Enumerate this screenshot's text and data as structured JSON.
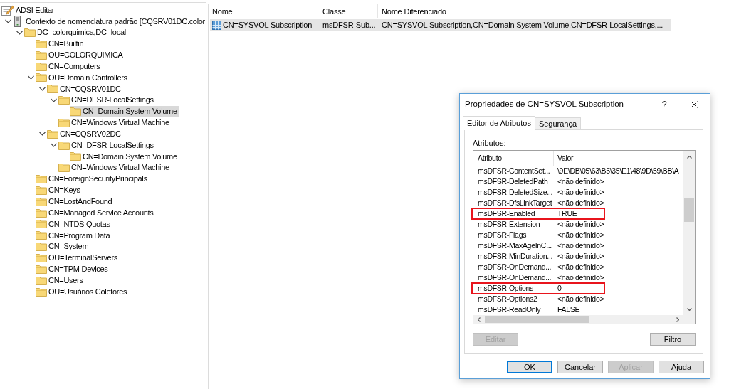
{
  "tree": {
    "items": [
      {
        "label": "ADSI Editar",
        "kind": "app",
        "selected": false,
        "children": [
          {
            "label": "Contexto de nomenclatura padrão [CQSRV01DC.color",
            "kind": "server",
            "expanded": true,
            "selected": false,
            "children": [
              {
                "label": "DC=colorquimica,DC=local",
                "kind": "folder",
                "expanded": true,
                "selected": false,
                "children": [
                  {
                    "label": "CN=Builtin",
                    "kind": "folder",
                    "selected": false
                  },
                  {
                    "label": "OU=COLORQUIMICA",
                    "kind": "folder",
                    "selected": false
                  },
                  {
                    "label": "CN=Computers",
                    "kind": "folder",
                    "selected": false
                  },
                  {
                    "label": "OU=Domain Controllers",
                    "kind": "folder",
                    "expanded": true,
                    "selected": false,
                    "children": [
                      {
                        "label": "CN=CQSRV01DC",
                        "kind": "folder",
                        "expanded": true,
                        "selected": false,
                        "children": [
                          {
                            "label": "CN=DFSR-LocalSettings",
                            "kind": "folder",
                            "expanded": true,
                            "selected": false,
                            "children": [
                              {
                                "label": "CN=Domain System Volume",
                                "kind": "folder",
                                "selected": true
                              }
                            ]
                          },
                          {
                            "label": "CN=Windows Virtual Machine",
                            "kind": "folder",
                            "selected": false
                          }
                        ]
                      },
                      {
                        "label": "CN=CQSRV02DC",
                        "kind": "folder",
                        "expanded": true,
                        "selected": false,
                        "children": [
                          {
                            "label": "CN=DFSR-LocalSettings",
                            "kind": "folder",
                            "expanded": true,
                            "selected": false,
                            "children": [
                              {
                                "label": "CN=Domain System Volume",
                                "kind": "folder",
                                "selected": false
                              }
                            ]
                          },
                          {
                            "label": "CN=Windows Virtual Machine",
                            "kind": "folder",
                            "selected": false
                          }
                        ]
                      }
                    ]
                  },
                  {
                    "label": "CN=ForeignSecurityPrincipals",
                    "kind": "folder",
                    "selected": false
                  },
                  {
                    "label": "CN=Keys",
                    "kind": "folder",
                    "selected": false
                  },
                  {
                    "label": "CN=LostAndFound",
                    "kind": "folder",
                    "selected": false
                  },
                  {
                    "label": "CN=Managed Service Accounts",
                    "kind": "folder",
                    "selected": false
                  },
                  {
                    "label": "CN=NTDS Quotas",
                    "kind": "folder",
                    "selected": false
                  },
                  {
                    "label": "CN=Program Data",
                    "kind": "folder",
                    "selected": false
                  },
                  {
                    "label": "CN=System",
                    "kind": "folder",
                    "selected": false
                  },
                  {
                    "label": "OU=TerminalServers",
                    "kind": "folder",
                    "selected": false
                  },
                  {
                    "label": "CN=TPM Devices",
                    "kind": "folder",
                    "selected": false
                  },
                  {
                    "label": "CN=Users",
                    "kind": "folder",
                    "selected": false
                  },
                  {
                    "label": "OU=Usuários Coletores",
                    "kind": "folder",
                    "selected": false
                  }
                ]
              }
            ]
          }
        ]
      }
    ]
  },
  "list": {
    "columns": [
      "Nome",
      "Classe",
      "Nome Diferenciado"
    ],
    "rows": [
      {
        "cells": [
          "CN=SYSVOL Subscription",
          "msDFSR-Sub...",
          "CN=SYSVOL Subscription,CN=Domain System Volume,CN=DFSR-LocalSettings,..."
        ],
        "selected": true
      }
    ]
  },
  "dialog": {
    "title": "Propriedades de CN=SYSVOL Subscription",
    "help_button": "?",
    "tabs": [
      {
        "label": "Editor de Atributos",
        "selected": true
      },
      {
        "label": "Segurança",
        "selected": false
      }
    ],
    "attributes_label": "Atributos:",
    "attribute_list": {
      "columns": [
        "Atributo",
        "Valor"
      ],
      "rows": [
        {
          "attribute": "msDFSR-ContentSet...",
          "value": "\\9E\\DB\\05\\63\\B5\\35\\E1\\48\\9D\\59\\BB\\A",
          "highlighted": false
        },
        {
          "attribute": "msDFSR-DeletedPath",
          "value": "<não definido>",
          "highlighted": false
        },
        {
          "attribute": "msDFSR-DeletedSize...",
          "value": "<não definido>",
          "highlighted": false
        },
        {
          "attribute": "msDFSR-DfsLinkTarget",
          "value": "<não definido>",
          "highlighted": false
        },
        {
          "attribute": "msDFSR-Enabled",
          "value": "TRUE",
          "highlighted": true
        },
        {
          "attribute": "msDFSR-Extension",
          "value": "<não definido>",
          "highlighted": false
        },
        {
          "attribute": "msDFSR-Flags",
          "value": "<não definido>",
          "highlighted": false
        },
        {
          "attribute": "msDFSR-MaxAgeInC...",
          "value": "<não definido>",
          "highlighted": false
        },
        {
          "attribute": "msDFSR-MinDuration...",
          "value": "<não definido>",
          "highlighted": false
        },
        {
          "attribute": "msDFSR-OnDemand...",
          "value": "<não definido>",
          "highlighted": false
        },
        {
          "attribute": "msDFSR-OnDemand...",
          "value": "<não definido>",
          "highlighted": false
        },
        {
          "attribute": "msDFSR-Options",
          "value": "0",
          "highlighted": true
        },
        {
          "attribute": "msDFSR-Options2",
          "value": "<não definido>",
          "highlighted": false
        },
        {
          "attribute": "msDFSR-ReadOnly",
          "value": "FALSE",
          "highlighted": false
        }
      ]
    },
    "panel_buttons": [
      {
        "label": "Editar",
        "disabled": true
      },
      {
        "label": "Filtro",
        "disabled": false
      }
    ],
    "buttons": [
      {
        "label": "OK",
        "default": true,
        "disabled": false
      },
      {
        "label": "Cancelar",
        "default": false,
        "disabled": false
      },
      {
        "label": "Aplicar",
        "default": false,
        "disabled": true
      },
      {
        "label": "Ajuda",
        "default": false,
        "disabled": false
      }
    ]
  }
}
